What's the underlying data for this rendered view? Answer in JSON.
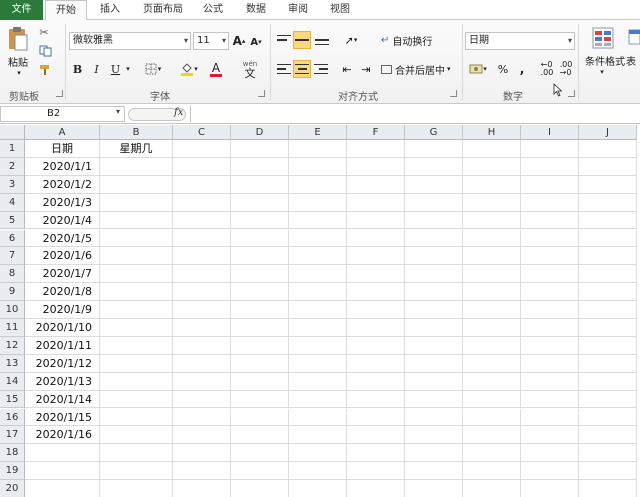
{
  "tabs": [
    "文件",
    "开始",
    "插入",
    "页面布局",
    "公式",
    "数据",
    "审阅",
    "视图"
  ],
  "clipboard": {
    "paste_label": "粘贴",
    "group_label": "剪贴板"
  },
  "font": {
    "name": "微软雅黑",
    "size": "11",
    "bold": "B",
    "italic": "I",
    "underline": "U",
    "color_letter": "A",
    "phonetic": "wén",
    "phonetic_char": "文",
    "group_label": "字体"
  },
  "alignment": {
    "wrap_label": "自动换行",
    "merge_label": "合并后居中",
    "group_label": "对齐方式"
  },
  "number": {
    "format": "日期",
    "percent": "%",
    "comma": ",",
    "group_label": "数字"
  },
  "styles": {
    "cond_format_label": "条件格式",
    "table_label": "表"
  },
  "name_box": "B2",
  "fx_label": "fx",
  "columns": [
    "A",
    "B",
    "C",
    "D",
    "E",
    "F",
    "G",
    "H",
    "I",
    "J"
  ],
  "rows": [
    "1",
    "2",
    "3",
    "4",
    "5",
    "6",
    "7",
    "8",
    "9",
    "10",
    "11",
    "12",
    "13",
    "14",
    "15",
    "16",
    "17",
    "18",
    "19",
    "20"
  ],
  "cells": {
    "A1": "日期",
    "B1": "星期几",
    "A": [
      "2020/1/1",
      "2020/1/2",
      "2020/1/3",
      "2020/1/4",
      "2020/1/5",
      "2020/1/6",
      "2020/1/7",
      "2020/1/8",
      "2020/1/9",
      "2020/1/10",
      "2020/1/11",
      "2020/1/12",
      "2020/1/13",
      "2020/1/14",
      "2020/1/15",
      "2020/1/16"
    ]
  },
  "colors": {
    "file_tab": "#2a7a3a",
    "highlight": "#fbd77d",
    "header_bg": "#e9ecf0"
  }
}
